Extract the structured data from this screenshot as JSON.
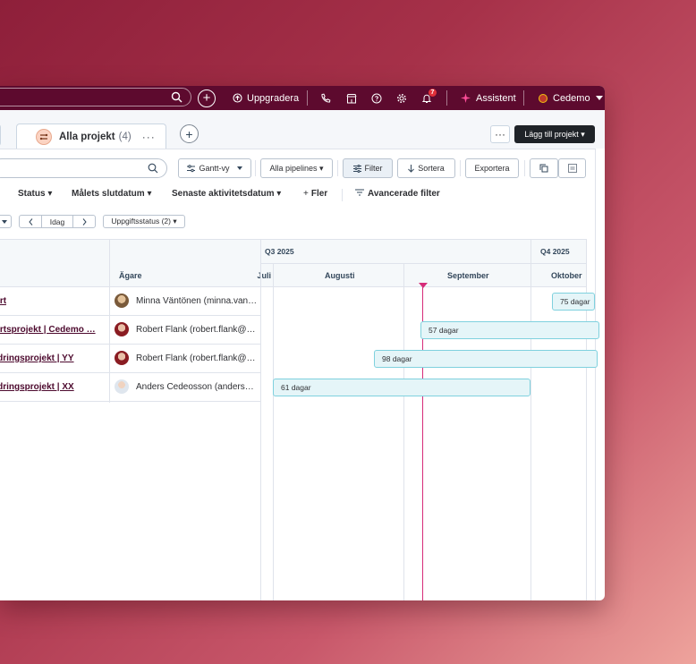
{
  "topbar": {
    "upgrade_label": "Uppgradera",
    "notifications_count": "7",
    "assistant_label": "Assistent",
    "account_label": "Cedemo"
  },
  "tabs": {
    "active": {
      "label": "Alla projekt",
      "count": "(4)",
      "more": "···"
    },
    "add_label": "+",
    "more_actions": "···",
    "add_project_label": "Lägg till projekt ▾"
  },
  "toolbar": {
    "view_label": "Gantt-vy",
    "pipelines_label": "Alla pipelines ▾",
    "filter_label": "Filter",
    "sort_label": "Sortera",
    "export_label": "Exportera"
  },
  "filters": {
    "status": "Status ▾",
    "target_date": "Målets slutdatum ▾",
    "last_activity": "Senaste aktivitetsdatum ▾",
    "more": "Fler",
    "advanced": "Avancerade filter"
  },
  "nav": {
    "today": "Idag",
    "task_status": "Uppgiftsstatus (2) ▾"
  },
  "grid": {
    "owner_header": "Ägare",
    "quarters": [
      "Q3 2025",
      "Q4 2025"
    ],
    "months": [
      "Juli",
      "Augusti",
      "September",
      "Oktober"
    ],
    "rows": [
      {
        "project": "tart",
        "owner": "Minna Väntönen (minna.van…",
        "bar": "75 dagar"
      },
      {
        "project": "tartsprojekt | Cedemo …",
        "owner": "Robert Flank (robert.flank@…",
        "bar": "57 dagar"
      },
      {
        "project": "ndringsprojekt | YY",
        "owner": "Robert Flank (robert.flank@…",
        "bar": "98 dagar"
      },
      {
        "project": "ndringsprojekt | XX",
        "owner": "Anders Cedeosson (anders…",
        "bar": "61 dagar"
      }
    ]
  },
  "colors": {
    "topbar": "#5d0a2e",
    "accent": "#d62c79",
    "bar_fill": "#e5f5f8",
    "bar_border": "#7fd1de"
  }
}
